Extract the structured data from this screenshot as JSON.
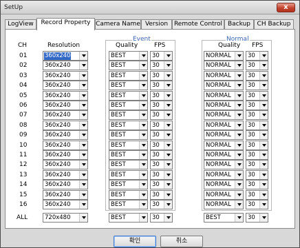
{
  "window": {
    "title": "SetUp",
    "close_label": "x"
  },
  "tabs": [
    {
      "label": "LogView"
    },
    {
      "label": "Record Property"
    },
    {
      "label": "Camera Name"
    },
    {
      "label": "Version"
    },
    {
      "label": "Remote Control"
    },
    {
      "label": "Backup"
    },
    {
      "label": "CH Backup"
    }
  ],
  "active_tab": "Record Property",
  "headers": {
    "ch": "CH",
    "resolution": "Resolution",
    "event_group": "Event",
    "normal_group": "Normal",
    "event_quality": "Quality",
    "event_fps": "FPS",
    "normal_quality": "Quality",
    "normal_fps": "FPS"
  },
  "rows": [
    {
      "ch": "01",
      "resolution": "360x240",
      "event_quality": "BEST",
      "event_fps": "30",
      "normal_quality": "NORMAL",
      "normal_fps": "30"
    },
    {
      "ch": "02",
      "resolution": "360x240",
      "event_quality": "BEST",
      "event_fps": "30",
      "normal_quality": "NORMAL",
      "normal_fps": "30"
    },
    {
      "ch": "03",
      "resolution": "360x240",
      "event_quality": "BEST",
      "event_fps": "30",
      "normal_quality": "NORMAL",
      "normal_fps": "30"
    },
    {
      "ch": "04",
      "resolution": "360x240",
      "event_quality": "BEST",
      "event_fps": "30",
      "normal_quality": "NORMAL",
      "normal_fps": "30"
    },
    {
      "ch": "05",
      "resolution": "360x240",
      "event_quality": "BEST",
      "event_fps": "30",
      "normal_quality": "NORMAL",
      "normal_fps": "30"
    },
    {
      "ch": "06",
      "resolution": "360x240",
      "event_quality": "BEST",
      "event_fps": "30",
      "normal_quality": "NORMAL",
      "normal_fps": "30"
    },
    {
      "ch": "07",
      "resolution": "360x240",
      "event_quality": "BEST",
      "event_fps": "30",
      "normal_quality": "NORMAL",
      "normal_fps": "30"
    },
    {
      "ch": "08",
      "resolution": "360x240",
      "event_quality": "BEST",
      "event_fps": "30",
      "normal_quality": "NORMAL",
      "normal_fps": "30"
    },
    {
      "ch": "09",
      "resolution": "360x240",
      "event_quality": "BEST",
      "event_fps": "30",
      "normal_quality": "NORMAL",
      "normal_fps": "30"
    },
    {
      "ch": "10",
      "resolution": "360x240",
      "event_quality": "BEST",
      "event_fps": "30",
      "normal_quality": "NORMAL",
      "normal_fps": "30"
    },
    {
      "ch": "11",
      "resolution": "360x240",
      "event_quality": "BEST",
      "event_fps": "30",
      "normal_quality": "NORMAL",
      "normal_fps": "30"
    },
    {
      "ch": "12",
      "resolution": "360x240",
      "event_quality": "BEST",
      "event_fps": "30",
      "normal_quality": "NORMAL",
      "normal_fps": "30"
    },
    {
      "ch": "13",
      "resolution": "360x240",
      "event_quality": "BEST",
      "event_fps": "30",
      "normal_quality": "NORMAL",
      "normal_fps": "30"
    },
    {
      "ch": "14",
      "resolution": "360x240",
      "event_quality": "BEST",
      "event_fps": "30",
      "normal_quality": "NORMAL",
      "normal_fps": "30"
    },
    {
      "ch": "15",
      "resolution": "360x240",
      "event_quality": "BEST",
      "event_fps": "30",
      "normal_quality": "NORMAL",
      "normal_fps": "30"
    },
    {
      "ch": "16",
      "resolution": "360x240",
      "event_quality": "BEST",
      "event_fps": "30",
      "normal_quality": "NORMAL",
      "normal_fps": "30"
    }
  ],
  "all_row": {
    "ch": "ALL",
    "resolution": "720x480",
    "event_quality": "BEST",
    "event_fps": "30",
    "normal_quality": "BEST",
    "normal_fps": "30"
  },
  "buttons": {
    "ok": "확인",
    "cancel": "취소"
  },
  "colors": {
    "accent": "#3168c6",
    "group_legend": "#3b64b0",
    "close": "#c3442e"
  }
}
